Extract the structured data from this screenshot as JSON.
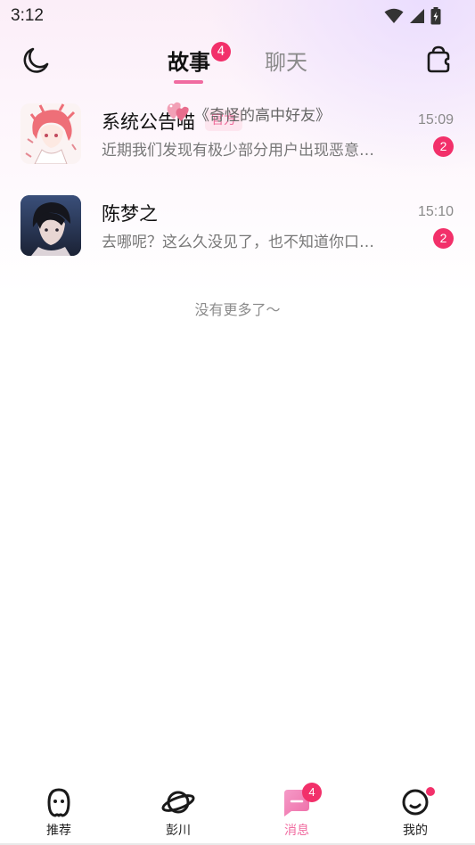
{
  "status_bar": {
    "time": "3:12",
    "icons": [
      "wifi-icon",
      "signal-icon",
      "battery-charging-icon"
    ]
  },
  "header": {
    "left_icon": "moon-icon",
    "right_icon": "shop-icon",
    "tabs": [
      {
        "label": "故事",
        "active": true,
        "badge": "4"
      },
      {
        "label": "聊天",
        "active": false
      }
    ]
  },
  "conversations": [
    {
      "name": "系统公告喵",
      "tag": "官方",
      "time": "15:09",
      "preview": "近期我们发现有极少部分用户出现恶意…",
      "unread": "2",
      "avatar": "anime-boy-pink-hair"
    },
    {
      "name": "陈梦之",
      "heart_icon": "hearts-icon",
      "story_title": "《奇怪的高中好友》",
      "time": "15:10",
      "preview": "去哪呢？这么久没见了，也不知道你口…",
      "unread": "2",
      "avatar": "anime-boy-dark-hair"
    }
  ],
  "list_end_text": "没有更多了～",
  "bottom_nav": [
    {
      "label": "推荐",
      "icon": "ghost-icon",
      "active": false
    },
    {
      "label": "彭川",
      "icon": "planet-icon",
      "active": false
    },
    {
      "label": "消息",
      "icon": "message-icon",
      "active": true,
      "badge": "4"
    },
    {
      "label": "我的",
      "icon": "smile-icon",
      "active": false,
      "dot": true
    }
  ],
  "colors": {
    "accent": "#f06ba0",
    "badge": "#f2306a",
    "tag_bg": "#fde6ef"
  }
}
